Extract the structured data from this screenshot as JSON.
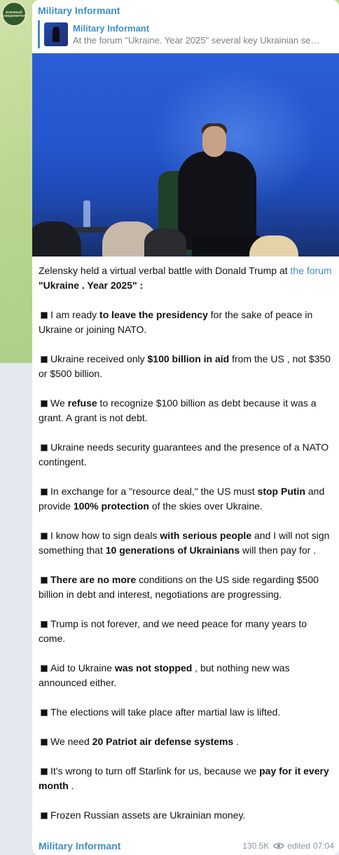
{
  "channel": {
    "name": "Military Informant",
    "avatar_text": "ВОЕННЫЙ ОСВЕДОМИТЕЛЬ"
  },
  "reply": {
    "title": "Military Informant",
    "snippet": "At the forum \"Ukraine. Year 2025\" several key Ukrainian se…"
  },
  "message": {
    "intro_a": "Zelensky held a virtual verbal battle with Donald Trump at ",
    "intro_link": "the forum",
    "intro_b": " \"Ukraine . Year 2025\" :",
    "items": [
      {
        "a": "I am ready ",
        "b": "to leave the presidency",
        "c": " for the sake of peace in Ukraine or joining NATO."
      },
      {
        "a": "Ukraine received only ",
        "b": "$100 billion in aid",
        "c": " from the US , not $350 or $500 billion."
      },
      {
        "a": "We ",
        "b": "refuse",
        "c": " to recognize $100 billion as debt because it was a grant. A grant is not debt."
      },
      {
        "a": "Ukraine needs security guarantees and the presence of a NATO contingent.",
        "b": "",
        "c": ""
      },
      {
        "a": "In exchange for a \"resource deal,\" the US must ",
        "b": "stop Putin",
        "c": " and provide ",
        "d": "100% protection",
        "e": " of the skies over Ukraine."
      },
      {
        "a": "I know how to sign deals ",
        "b": "with serious people",
        "c": " and I will not sign something that ",
        "d": "10 generations of Ukrainians",
        "e": " will then pay for ."
      },
      {
        "a": "",
        "b": "There are no more",
        "c": " conditions on the US side regarding $500 billion in debt and interest, negotiations are progressing."
      },
      {
        "a": "Trump is not forever, and we need peace for many years to come.",
        "b": "",
        "c": ""
      },
      {
        "a": "Aid to Ukraine ",
        "b": "was not stopped",
        "c": " , but nothing new was announced either."
      },
      {
        "a": "The elections will take place after martial law is lifted.",
        "b": "",
        "c": ""
      },
      {
        "a": "We need ",
        "b": "20 Patriot air defense systems",
        "c": " ."
      },
      {
        "a": "It's wrong to turn off Starlink for us, because we ",
        "b": "pay for it every month",
        "c": " ."
      },
      {
        "a": "Frozen Russian assets are Ukrainian money.",
        "b": "",
        "c": ""
      }
    ]
  },
  "footer": {
    "signature": "Military Informant",
    "views": "130.5K",
    "edited": "edited",
    "time": "07:04"
  },
  "colors": {
    "accent": "#3d8fc5",
    "meta": "#8d949a"
  }
}
